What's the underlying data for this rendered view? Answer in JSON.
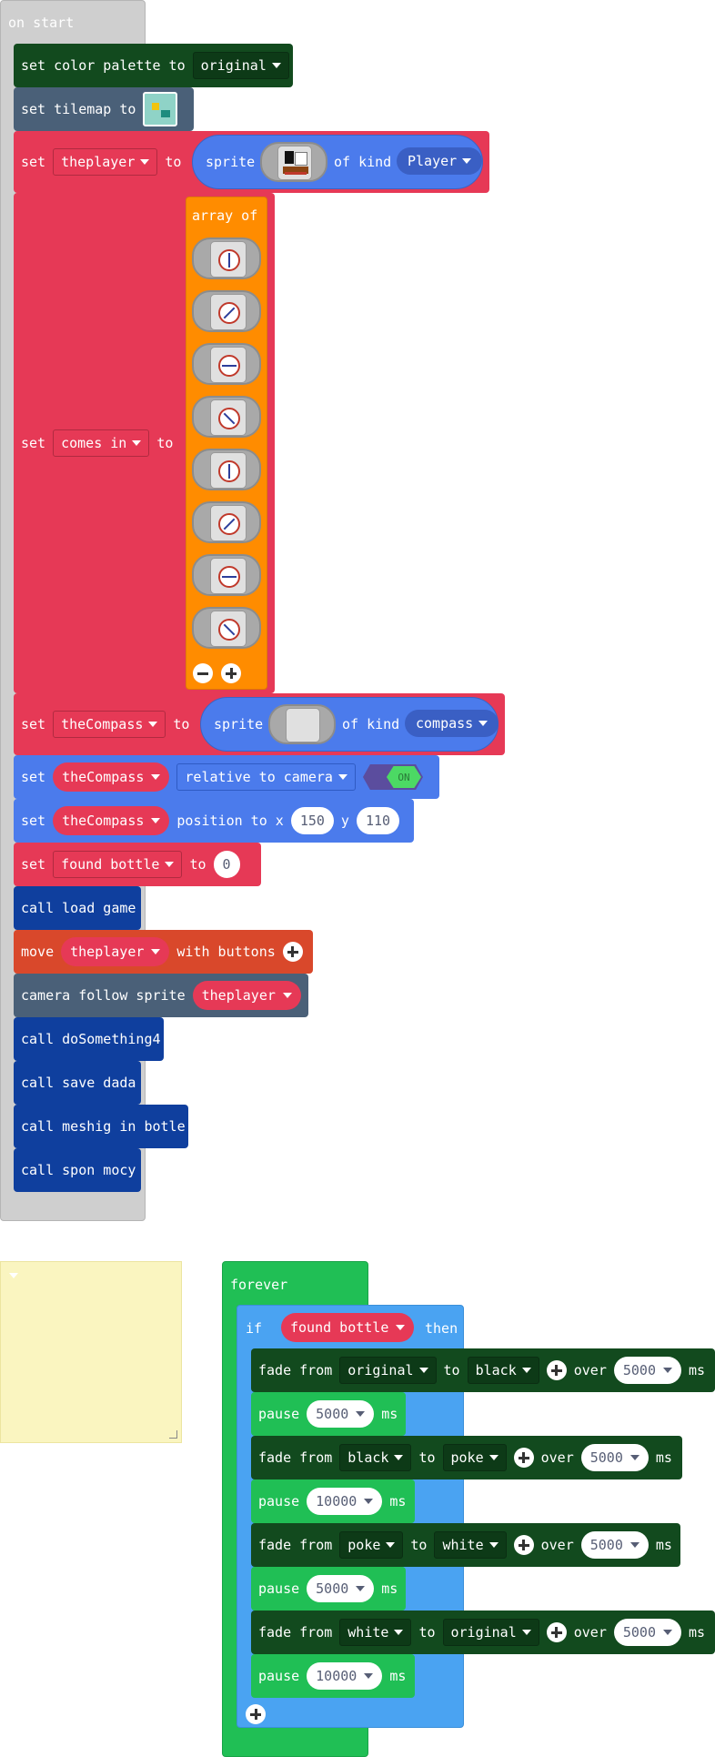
{
  "colors": {
    "event": "#cfcfcf",
    "scene": "#124a1e",
    "sprite_set": "#e63956",
    "sprite_reporter": "#4b7bec",
    "array": "#ff8c00",
    "func": "#0f3f9e",
    "controller": "#d9482b",
    "loop": "#20bf55",
    "logic": "#4aa3f2",
    "note": "#faf5c0"
  },
  "on_start": {
    "label": "on start",
    "set_palette": {
      "text": "set color palette to",
      "value": "original"
    },
    "set_tilemap": {
      "text": "set tilemap to",
      "icon": "tilemap-icon"
    },
    "set_player": {
      "set": "set",
      "var": "theplayer",
      "to": "to",
      "sprite": "sprite",
      "of_kind": "of kind",
      "kind": "Player",
      "icon": "pirate-ship-icon"
    },
    "set_comes_in": {
      "set": "set",
      "var": "comes in",
      "to": "to",
      "array_of": "array of",
      "item_count": 8,
      "icon": "compass-dial-icon"
    },
    "set_compass": {
      "set": "set",
      "var": "theCompass",
      "to": "to",
      "sprite": "sprite",
      "of_kind": "of kind",
      "kind": "compass"
    },
    "set_relative": {
      "set": "set",
      "var": "theCompass",
      "flag": "relative to camera",
      "toggle": "ON"
    },
    "set_position": {
      "set": "set",
      "var": "theCompass",
      "text": "position to x",
      "x": "150",
      "y_label": "y",
      "y": "110"
    },
    "set_found": {
      "set": "set",
      "var": "found bottle",
      "to": "to",
      "value": "0"
    },
    "call_load": "call load game",
    "move": {
      "move": "move",
      "var": "theplayer",
      "with": "with buttons"
    },
    "camera": {
      "text": "camera follow sprite",
      "var": "theplayer"
    },
    "call_do": "call doSomething4",
    "call_save": "call save dada",
    "call_meshig": "call meshig in botle",
    "call_spon": "call spon mocy"
  },
  "forever": {
    "label": "forever",
    "if": {
      "if": "if",
      "var": "found bottle",
      "then": "then"
    },
    "steps": [
      {
        "type": "fade",
        "from_label": "fade from",
        "from": "original",
        "to_label": "to",
        "to": "black",
        "over": "over",
        "ms_value": "5000",
        "ms": "ms"
      },
      {
        "type": "pause",
        "label": "pause",
        "value": "5000",
        "ms": "ms"
      },
      {
        "type": "fade",
        "from_label": "fade from",
        "from": "black",
        "to_label": "to",
        "to": "poke",
        "over": "over",
        "ms_value": "5000",
        "ms": "ms"
      },
      {
        "type": "pause",
        "label": "pause",
        "value": "10000",
        "ms": "ms"
      },
      {
        "type": "fade",
        "from_label": "fade from",
        "from": "poke",
        "to_label": "to",
        "to": "white",
        "over": "over",
        "ms_value": "5000",
        "ms": "ms"
      },
      {
        "type": "pause",
        "label": "pause",
        "value": "5000",
        "ms": "ms"
      },
      {
        "type": "fade",
        "from_label": "fade from",
        "from": "white",
        "to_label": "to",
        "to": "original",
        "over": "over",
        "ms_value": "5000",
        "ms": "ms"
      },
      {
        "type": "pause",
        "label": "pause",
        "value": "10000",
        "ms": "ms"
      }
    ]
  },
  "note": {
    "text": ""
  }
}
